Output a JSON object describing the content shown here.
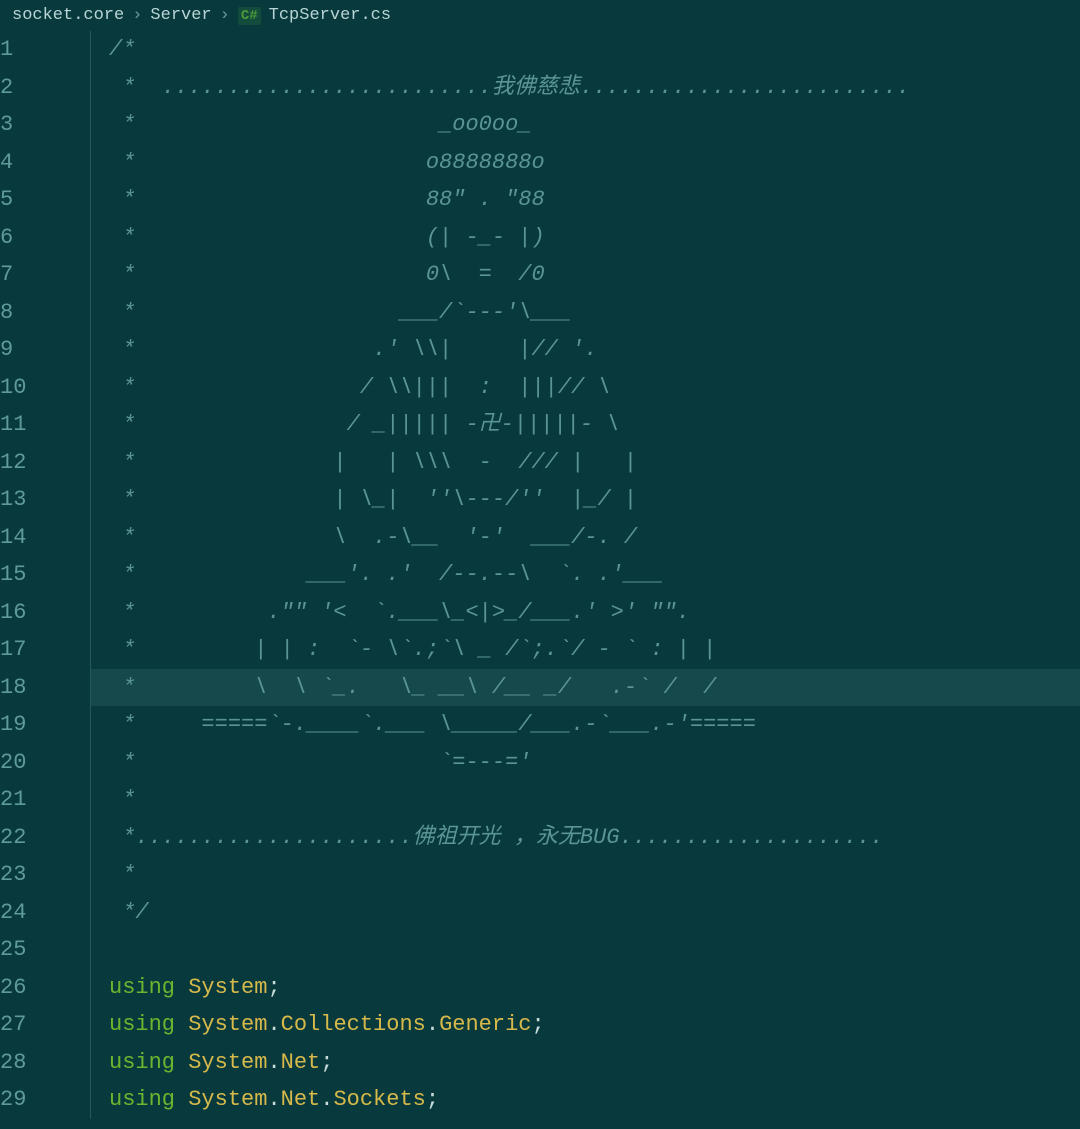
{
  "breadcrumb": {
    "seg1": "socket.core",
    "seg2": "Server",
    "lang": "C#",
    "file": "TcpServer.cs"
  },
  "lines": {
    "n1": "1",
    "n2": "2",
    "n3": "3",
    "n4": "4",
    "n5": "5",
    "n6": "6",
    "n7": "7",
    "n8": "8",
    "n9": "9",
    "n10": "10",
    "n11": "11",
    "n12": "12",
    "n13": "13",
    "n14": "14",
    "n15": "15",
    "n16": "16",
    "n17": "17",
    "n18": "18",
    "n19": "19",
    "n20": "20",
    "n21": "21",
    "n22": "22",
    "n23": "23",
    "n24": "24",
    "n25": "25",
    "n26": "26",
    "n27": "27",
    "n28": "28",
    "n29": "29"
  },
  "comment": {
    "l1": "/*",
    "l2": " *  .........................我佛慈悲.........................",
    "l3": " *                       _oo0oo_",
    "l4": " *                      o8888888o",
    "l5": " *                      88\" . \"88",
    "l6": " *                      (| -_- |)",
    "l7": " *                      0\\  =  /0",
    "l8": " *                    ___/`---'\\___",
    "l9": " *                  .' \\\\|     |// '.",
    "l10": " *                 / \\\\|||  :  |||// \\",
    "l11": " *                / _||||| -卍-|||||- \\",
    "l12": " *               |   | \\\\\\  -  /// |   |",
    "l13": " *               | \\_|  ''\\---/''  |_/ |",
    "l14": " *               \\  .-\\__  '-'  ___/-. /",
    "l15": " *             ___'. .'  /--.--\\  `. .'___",
    "l16": " *          .\"\" '<  `.___\\_<|>_/___.' >' \"\".",
    "l17": " *         | | :  `- \\`.;`\\ _ /`;.`/ - ` : | |",
    "l18": " *         \\  \\ `_.   \\_ __\\ /__ _/   .-` /  /",
    "l19": " *     =====`-.____`.___ \\_____/___.-`___.-'=====",
    "l20": " *                       `=---='",
    "l21": " *",
    "l22": " *.....................佛祖开光 ，永无BUG....................",
    "l23": " *",
    "l24": " */"
  },
  "code": {
    "using": "using ",
    "system": "System",
    "collections": "Collections",
    "generic": "Generic",
    "net": "Net",
    "sockets": "Sockets",
    "dot": ".",
    "semi": ";"
  }
}
